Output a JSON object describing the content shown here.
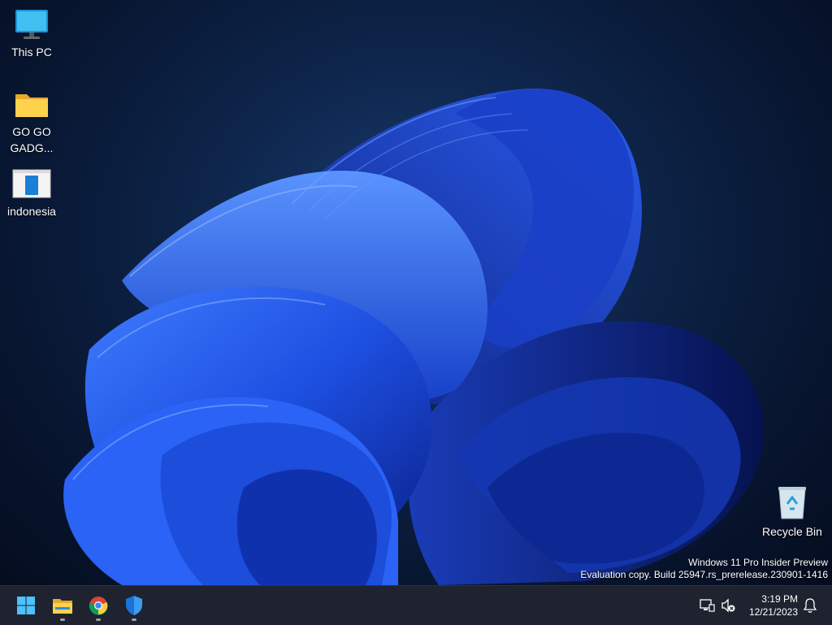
{
  "desktop": {
    "icons": [
      {
        "label": "This PC",
        "icon": "monitor-icon"
      },
      {
        "label": "GO GO GADG...",
        "icon": "folder-icon"
      },
      {
        "label": "indonesia",
        "icon": "document-window-icon"
      },
      {
        "label": "Recycle Bin",
        "icon": "recycle-bin-icon"
      }
    ],
    "watermark": {
      "line1": "Windows 11 Pro Insider Preview",
      "line2": "Evaluation copy. Build 25947.rs_prerelease.230901-1416"
    }
  },
  "taskbar": {
    "apps": [
      {
        "name": "Start",
        "icon": "windows-start-icon"
      },
      {
        "name": "File Explorer",
        "icon": "file-explorer-icon",
        "running": true
      },
      {
        "name": "Google Chrome",
        "icon": "chrome-icon",
        "running": true
      },
      {
        "name": "Windows Security",
        "icon": "shield-icon",
        "running": true
      }
    ],
    "tray": {
      "icons": [
        "network-icon",
        "volume-muted-icon",
        "notification-bell-icon"
      ],
      "time": "3:19 PM",
      "date": "12/21/2023"
    }
  },
  "colors": {
    "taskbar_bg": "#1f2330",
    "wallpaper_bloom": "#1e55e6",
    "wallpaper_bg": "#081631"
  }
}
